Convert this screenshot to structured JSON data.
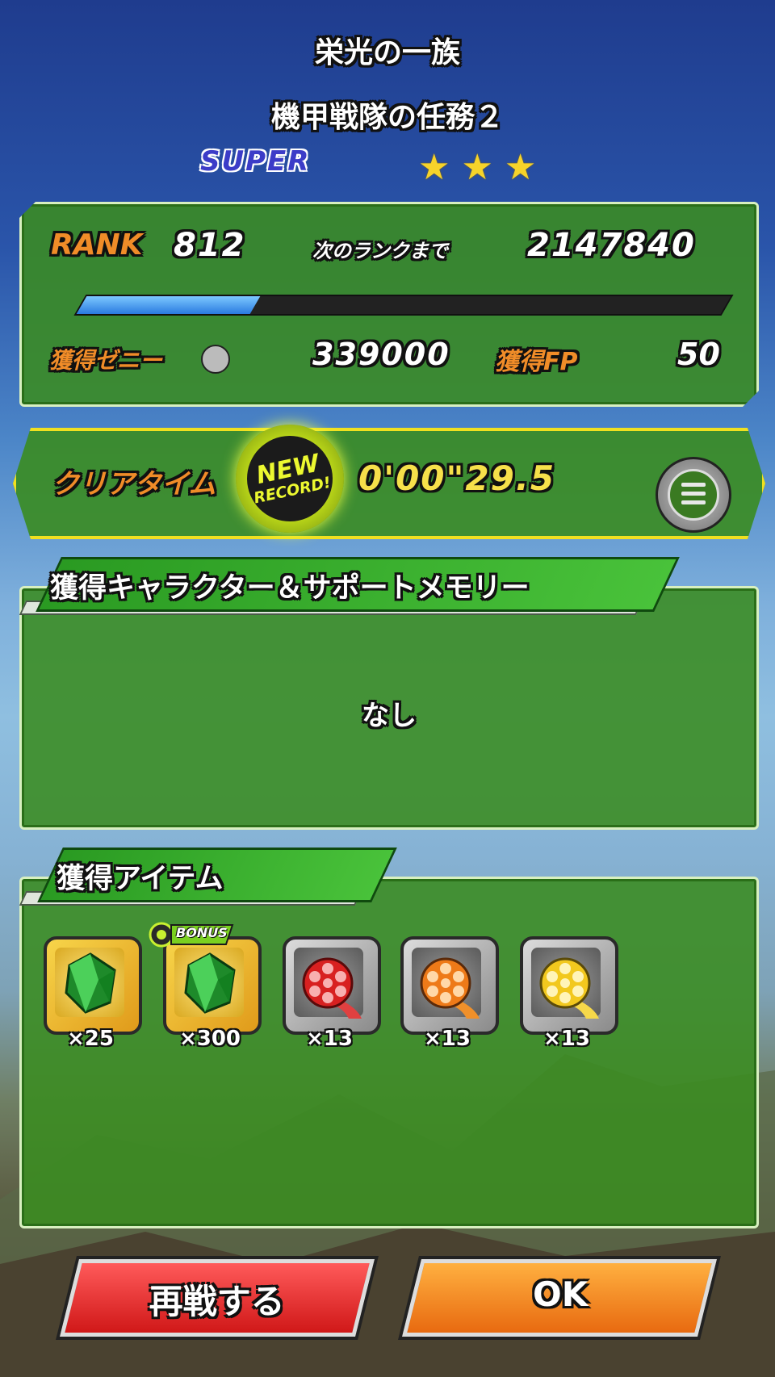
{
  "header": {
    "event_title": "栄光の一族",
    "stage_title": "機甲戦隊の任務２",
    "difficulty": "SUPER",
    "stars": "★★★"
  },
  "rank": {
    "label": "RANK",
    "value": "812",
    "next_label": "次のランクまで",
    "next_value": "2147840",
    "progress": 0.27
  },
  "rewards": {
    "zeni_label": "獲得ゼニー",
    "zeni_value": "339000",
    "fp_label": "獲得FP",
    "fp_value": "50"
  },
  "clear_time": {
    "label": "クリアタイム",
    "badge_new": "NEW",
    "badge_record": "RECORD!",
    "value": "0'00\"29.5"
  },
  "characters": {
    "header": "獲得キャラクター＆サポートメモリー",
    "empty_text": "なし"
  },
  "items": {
    "header": "獲得アイテム",
    "bonus_label": "BONUS",
    "list": [
      {
        "icon": "green-crystal-icon",
        "qty": "×25"
      },
      {
        "icon": "green-crystal-icon",
        "qty": "×300"
      },
      {
        "icon": "red-film-reel-icon",
        "qty": "×13"
      },
      {
        "icon": "orange-film-reel-icon",
        "qty": "×13"
      },
      {
        "icon": "yellow-film-reel-icon",
        "qty": "×13"
      }
    ]
  },
  "buttons": {
    "retry": "再戦する",
    "ok": "OK"
  },
  "colors": {
    "panel_green": "#3a8c20",
    "accent_orange": "#f08c28",
    "time_border": "#f0e020",
    "progress_blue": "#2a7ae0",
    "retry_red": "#d01818",
    "ok_orange": "#e86a10"
  }
}
